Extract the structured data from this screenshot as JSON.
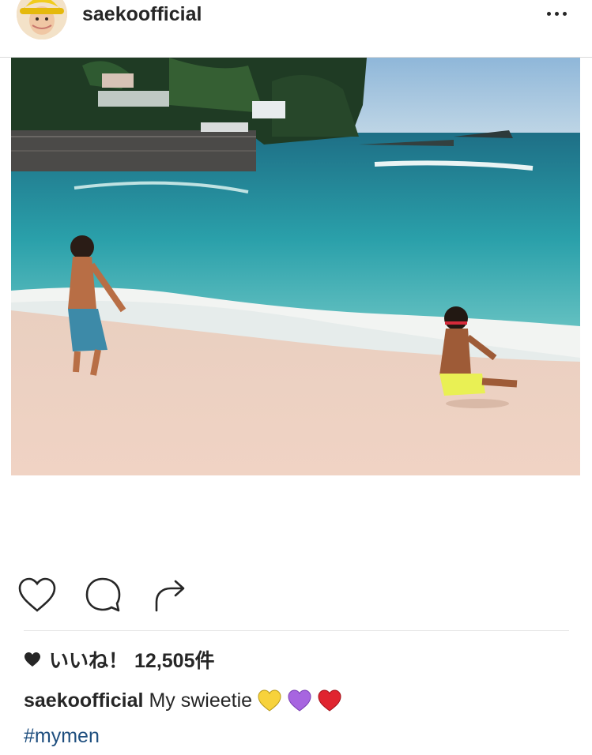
{
  "post": {
    "username": "saekoofficial",
    "likes_label": "いいね！",
    "likes_count": "12,505件",
    "caption_username": "saekoofficial",
    "caption_text": "My swieetie",
    "caption_emojis": [
      "yellow-heart",
      "purple-heart",
      "red-heart"
    ],
    "hashtag": "#mymen"
  },
  "icons": {
    "more": "more-options-icon",
    "like": "heart-outline-icon",
    "comment": "comment-bubble-icon",
    "share": "share-arrow-icon",
    "likes_heart": "filled-heart-icon"
  },
  "colors": {
    "text": "#262626",
    "hashtag": "#1f4f7f",
    "divider": "#dbdbdb",
    "yellow_heart": "#f7d23b",
    "purple_heart": "#a765e0",
    "red_heart": "#e0242f"
  }
}
